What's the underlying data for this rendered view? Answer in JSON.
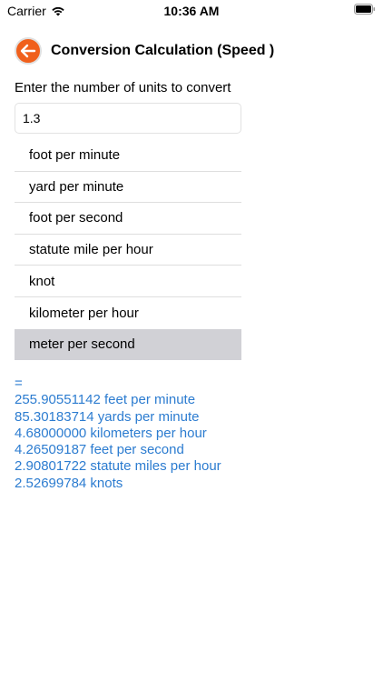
{
  "status_bar": {
    "carrier": "Carrier",
    "time": "10:36 AM"
  },
  "header": {
    "title": "Conversion Calculation (Speed )",
    "back_icon": "arrow-left-circle-icon",
    "accent_color": "#f0601c"
  },
  "prompt": "Enter the number of units to convert",
  "input": {
    "value": "1.3",
    "placeholder": ""
  },
  "units": [
    "foot per minute",
    "yard per minute",
    "foot per second",
    "statute mile per hour",
    "knot",
    "kilometer per hour",
    "meter per second"
  ],
  "selected_unit": "meter per second",
  "results": {
    "equals": "=",
    "lines": [
      "255.90551142 feet per minute",
      "85.30183714 yards per minute",
      "4.68000000 kilometers per hour",
      "4.26509187 feet per second",
      "2.90801722 statute miles per hour",
      "2.52699784 knots"
    ],
    "color": "#2c7cd0"
  }
}
